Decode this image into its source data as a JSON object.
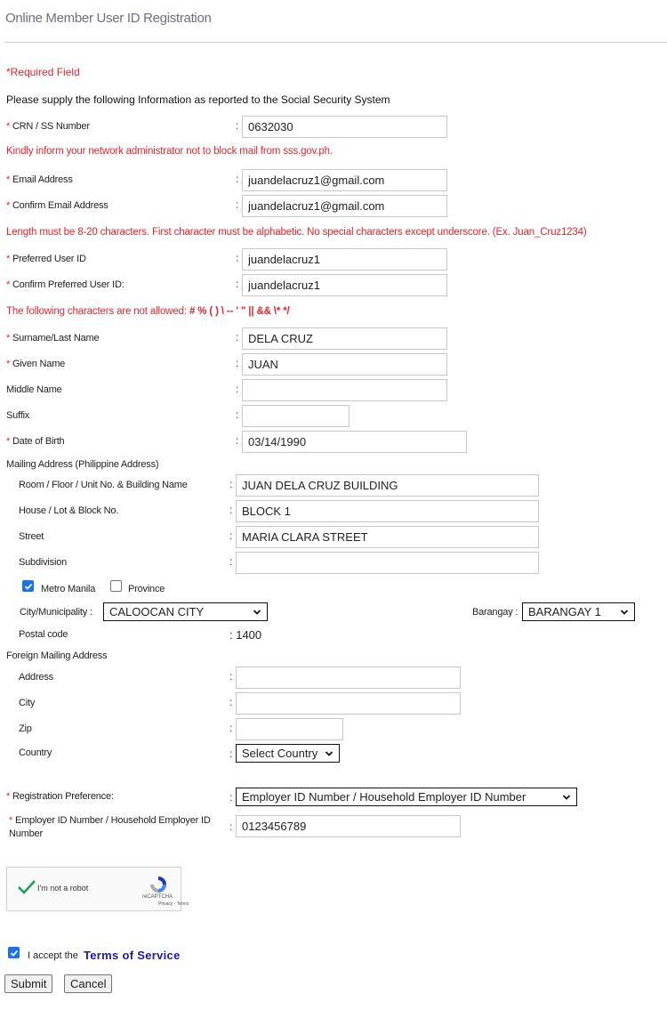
{
  "page": {
    "title": "Online Member User ID Registration",
    "required_note": "*Required Field",
    "intro": "Please supply the following Information as reported to the Social Security System"
  },
  "notes": {
    "mail_notice": "Kindly inform your network administrator not to block mail from sss.gov.ph.",
    "userid_rules": "Length must be 8-20 characters. First character must be alphabetic. No special characters except underscore. (Ex. Juan_Cruz1234)",
    "disallowed_prefix": "The following characters are not allowed: ",
    "disallowed_chars": "# % ( ) \\ -- ' \" || && \\* */"
  },
  "fields": {
    "crn": {
      "label": "CRN / SS Number",
      "value": "0632030",
      "required": true
    },
    "email": {
      "label": "Email Address",
      "value": "juandelacruz1@gmail.com",
      "required": true
    },
    "confirm_email": {
      "label": "Confirm Email Address",
      "value": "juandelacruz1@gmail.com",
      "required": true
    },
    "user_id": {
      "label": "Preferred User ID",
      "value": "juandelacruz1",
      "required": true
    },
    "confirm_user_id": {
      "label": "Confirm Preferred User ID:",
      "value": "juandelacruz1",
      "required": true
    },
    "surname": {
      "label": "Surname/Last Name",
      "value": "DELA CRUZ",
      "required": true
    },
    "given_name": {
      "label": "Given Name",
      "value": "JUAN",
      "required": true
    },
    "middle_name": {
      "label": "Middle Name",
      "value": ""
    },
    "suffix": {
      "label": "Suffix",
      "value": ""
    },
    "dob": {
      "label": "Date of Birth",
      "value": "03/14/1990",
      "required": true
    }
  },
  "mailing": {
    "heading": "Mailing Address (Philippine Address)",
    "room": {
      "label": "Room / Floor / Unit No. & Building Name",
      "value": "JUAN DELA CRUZ BUILDING"
    },
    "house": {
      "label": "House / Lot & Block No.",
      "value": "BLOCK 1"
    },
    "street": {
      "label": "Street",
      "value": "MARIA CLARA STREET"
    },
    "subdivision": {
      "label": "Subdivision",
      "value": ""
    },
    "metro_manila": {
      "label": "Metro Manila",
      "checked": true
    },
    "province": {
      "label": "Province",
      "checked": false
    },
    "city": {
      "label": "City/Municipality :",
      "value": "CALOOCAN CITY"
    },
    "barangay": {
      "label": "Barangay :",
      "value": "BARANGAY 1"
    },
    "postal": {
      "label": "Postal code",
      "value": ": 1400"
    }
  },
  "foreign": {
    "heading": "Foreign Mailing Address",
    "address": {
      "label": "Address",
      "value": ""
    },
    "city": {
      "label": "City",
      "value": ""
    },
    "zip": {
      "label": "Zip",
      "value": ""
    },
    "country": {
      "label": "Country",
      "value": "Select Country"
    }
  },
  "registration": {
    "preference": {
      "label": "Registration Preference:",
      "value": "Employer ID Number / Household Employer ID Number",
      "required": true
    },
    "employer_id": {
      "label_line1": "Employer ID Number / Household Employer ID",
      "label_line2": "Number",
      "value": "0123456789",
      "required": true
    }
  },
  "captcha": {
    "label": "I'm not a robot",
    "brand": "reCAPTCHA",
    "links": "Privacy - Terms",
    "checked": true
  },
  "terms": {
    "prefix": "I accept the",
    "link": "Terms of Service",
    "checked": true
  },
  "buttons": {
    "submit": "Submit",
    "cancel": "Cancel"
  },
  "colors": {
    "required": "#e8232b",
    "title": "#6e6e80",
    "link": "#1a1aa6",
    "checkbox": "#1a73e8",
    "captcha_check": "#1e9e5a"
  }
}
